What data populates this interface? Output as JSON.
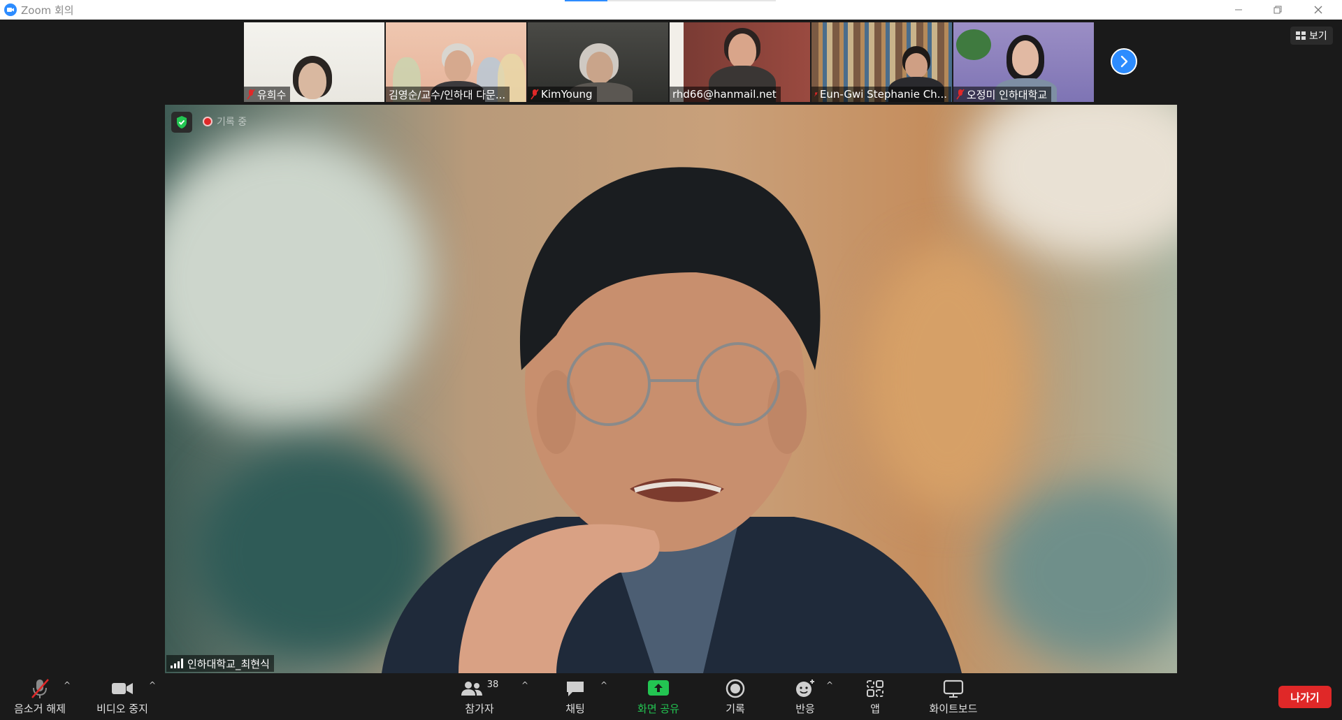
{
  "window": {
    "title": "Zoom 회의"
  },
  "thumbnails": [
    {
      "name": "유희수",
      "muted": true
    },
    {
      "name": "김영순/교수/인하대 다문...",
      "muted": false
    },
    {
      "name": "KimYoung",
      "muted": true
    },
    {
      "name": "rhd66@hanmail.net",
      "muted": false
    },
    {
      "name": "Eun-Gwi Stephanie Ch...",
      "muted": true
    },
    {
      "name": "오정미 인하대학교",
      "muted": true
    }
  ],
  "view_button": {
    "label": "보기"
  },
  "main": {
    "speaker_name": "인하대학교_최현식",
    "recording_label": "기록 중"
  },
  "toolbar": {
    "unmute": "음소거 해제",
    "stop_video": "비디오 중지",
    "participants": "참가자",
    "participants_count": "38",
    "chat": "채팅",
    "share_screen": "화면 공유",
    "record": "기록",
    "reactions": "반응",
    "apps": "앱",
    "whiteboard": "화이트보드",
    "leave": "나가기"
  },
  "colors": {
    "accent": "#2d8cff",
    "share_green": "#23c552",
    "leave_red": "#e02828"
  }
}
